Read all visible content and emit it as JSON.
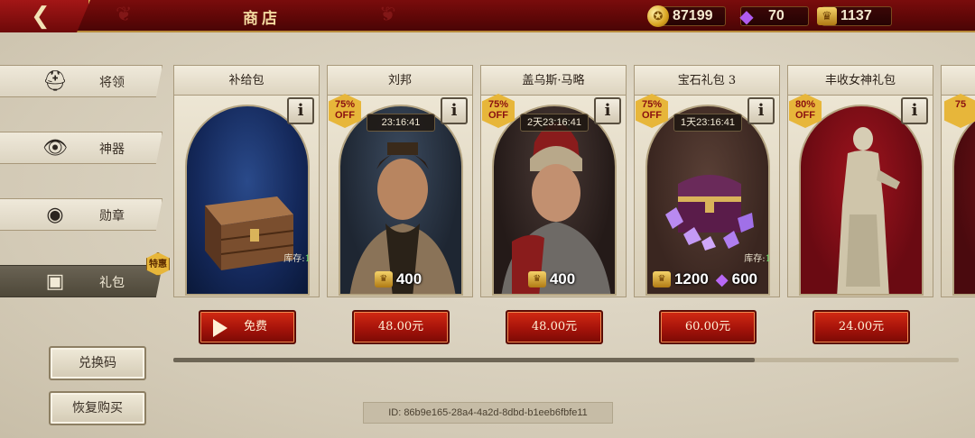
{
  "header": {
    "title": "商店",
    "back_icon": "chevron-left-icon"
  },
  "currencies": [
    {
      "icon": "gold-coin-icon",
      "value": "87199"
    },
    {
      "icon": "purple-gem-icon",
      "value": "70"
    },
    {
      "icon": "gold-token-icon",
      "value": "1137"
    }
  ],
  "sidebar": {
    "items": [
      {
        "label": "将领",
        "icon": "spartan-helmet-icon"
      },
      {
        "label": "神器",
        "icon": "eye-of-horus-icon"
      },
      {
        "label": "勋章",
        "icon": "eagle-medal-icon"
      },
      {
        "label": "礼包",
        "icon": "chest-icon",
        "badge": "特惠"
      }
    ],
    "active_index": 3,
    "redeem_label": "兑换码",
    "restore_label": "恢复购买"
  },
  "cards": [
    {
      "title": "补给包",
      "stock_label": "库存:",
      "stock_value": "1",
      "button_label": "免费"
    },
    {
      "title": "刘邦",
      "discount_pct": "75%",
      "discount_off": "OFF",
      "timer": "23:16:41",
      "reward_token": "400",
      "button_label": "48.00元"
    },
    {
      "title": "盖乌斯·马略",
      "discount_pct": "75%",
      "discount_off": "OFF",
      "timer": "2天23:16:41",
      "reward_token": "400",
      "button_label": "48.00元"
    },
    {
      "title": "宝石礼包 3",
      "discount_pct": "75%",
      "discount_off": "OFF",
      "timer": "1天23:16:41",
      "stock_label": "库存:",
      "stock_value": "1",
      "reward_token": "1200",
      "reward_gem": "600",
      "button_label": "60.00元"
    },
    {
      "title": "丰收女神礼包",
      "discount_pct": "80%",
      "discount_off": "OFF",
      "button_label": "24.00元"
    },
    {
      "discount_pct": "75"
    }
  ],
  "scroll": {
    "position_fraction": 0.74
  },
  "footer": {
    "device_id": "ID: 86b9e165-28a4-4a2d-8dbd-b1eeb6fbfe11"
  },
  "colors": {
    "brand_red": "#7a0c0c",
    "gold": "#e7b63a",
    "button_red": "#b3160b",
    "parchment": "#d9d1bf"
  }
}
